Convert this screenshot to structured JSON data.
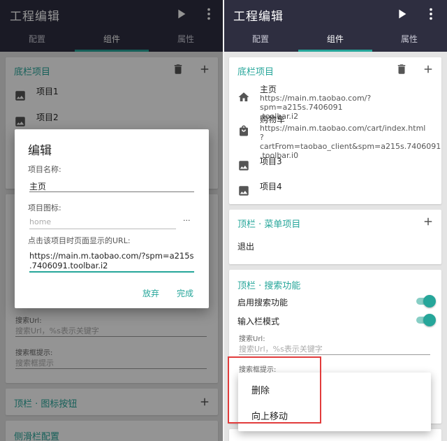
{
  "app": {
    "title": "工程编辑"
  },
  "tabs": [
    "配置",
    "组件",
    "属性"
  ],
  "bottom_bar": {
    "title": "底栏项目",
    "items": [
      {
        "label": "主页",
        "url": "https://main.m.taobao.com/?spm=a215s.7406091\n.toolbar.i2",
        "icon": "home-icon"
      },
      {
        "label": "购物车",
        "url": "https://main.m.taobao.com/cart/index.html\n?cartFrom=taobao_client&spm=a215s.7406091\n.toolbar.i0",
        "icon": "shopping-bag-icon"
      },
      {
        "label": "项目3",
        "url": "",
        "icon": "image-icon"
      },
      {
        "label": "项目4",
        "url": "",
        "icon": "image-icon"
      }
    ]
  },
  "left_bottom_bar_items": [
    "项目1",
    "项目2"
  ],
  "top_menu": {
    "title": "顶栏 · 菜单项目",
    "items": [
      "退出"
    ]
  },
  "search": {
    "title": "顶栏 · 搜索功能",
    "enable_label": "启用搜索功能",
    "input_mode_label": "输入栏模式",
    "url_label": "搜索Url:",
    "url_placeholder": "搜索Url，%s表示关键字",
    "hint_label": "搜索框提示:",
    "hint_placeholder": "搜索框提示"
  },
  "top_icon_buttons": {
    "title": "顶栏 · 图标按钮"
  },
  "side_bar": {
    "title": "侧滑栏配置"
  },
  "dialog": {
    "title": "编辑",
    "name_label": "项目名称:",
    "name_value": "主页",
    "icon_label": "项目图标:",
    "icon_placeholder": "home",
    "icon_more": "···",
    "url_label": "点击该项目时页面显示的URL:",
    "url_value": "https://main.m.taobao.com/?spm=a215s\n.7406091.toolbar.i2",
    "cancel": "放弃",
    "done": "完成"
  },
  "context_menu": {
    "items": [
      "删除",
      "向上移动"
    ]
  },
  "colors": {
    "accent": "#26a69a",
    "appbar": "#2e2e40",
    "highlight": "#e23c3c"
  }
}
